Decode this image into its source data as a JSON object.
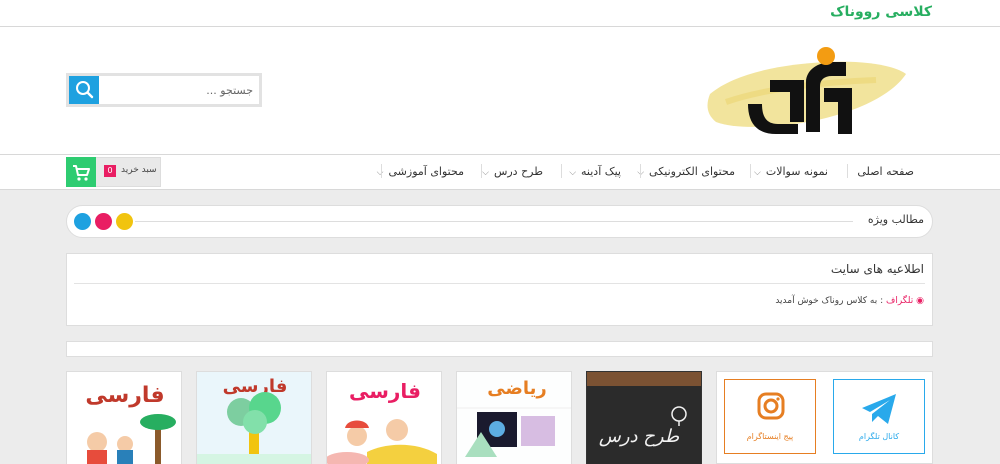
{
  "site_title": "کلاسی رووناک",
  "search": {
    "placeholder": "جستجو ..."
  },
  "nav": {
    "home": "صفحه اصلی",
    "sample_questions": "نمونه سوالات",
    "electronic_content": "محتوای الکترونیکی",
    "peyk_adineh": "پیک آدینه",
    "lesson_plan": "طرح درس",
    "educational_content": "محتوای آموزشی"
  },
  "cart": {
    "label": "سبد خرید",
    "count": "0"
  },
  "featured": {
    "title": "مطالب ویژه"
  },
  "notices": {
    "title": "اطلاعیه های سایت",
    "items": [
      {
        "tag": "تلگراف",
        "separator": ":",
        "text": "به کلاس روناک خوش آمدید"
      }
    ]
  },
  "cards": {
    "farsi_1": "فارسی",
    "farsi_2": "فارسی",
    "farsi_3": "فارسی",
    "math": "ریاضی",
    "tarh_dars": "طرح درس"
  },
  "social": {
    "instagram": "پیج اینستاگرام",
    "telegram": "کانال تلگرام"
  },
  "colors": {
    "brand_green": "#27ae60",
    "search_blue": "#1ea1e0",
    "cart_green": "#2ecc71",
    "accent_pink": "#e91e63",
    "dot_blue": "#1ea1e0",
    "dot_pink": "#e91e63",
    "dot_yellow": "#f1c40f",
    "instagram_orange": "#e67e22",
    "telegram_blue": "#29a9eb"
  },
  "icons": [
    "search-icon",
    "cart-icon",
    "chevron-down-icon",
    "instagram-icon",
    "telegram-icon",
    "bullet-icon"
  ]
}
